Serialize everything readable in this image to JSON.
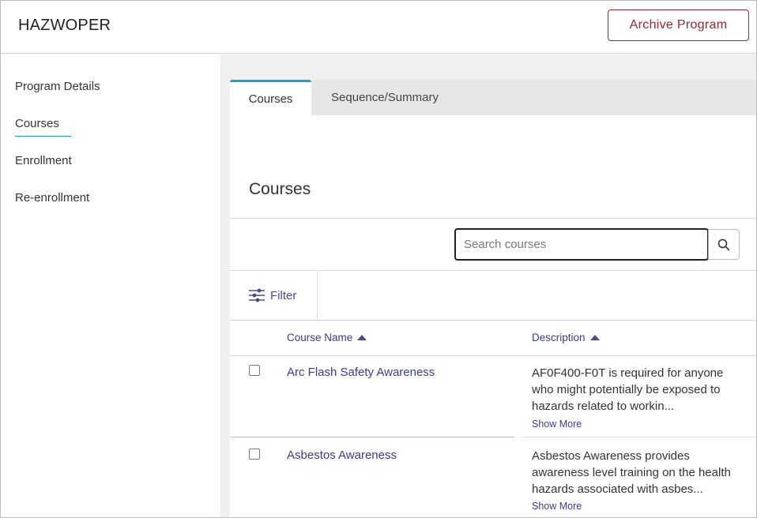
{
  "header": {
    "title": "HAZWOPER",
    "archive_label": "Archive Program"
  },
  "sidebar": {
    "items": [
      {
        "label": "Program Details"
      },
      {
        "label": "Courses",
        "active": true
      },
      {
        "label": "Enrollment"
      },
      {
        "label": "Re-enrollment"
      }
    ]
  },
  "tabs": [
    {
      "label": "Courses",
      "active": true
    },
    {
      "label": "Sequence/Summary"
    }
  ],
  "panel": {
    "title": "Courses",
    "search": {
      "placeholder": "Search courses",
      "value": ""
    },
    "filter_label": "Filter",
    "columns": [
      {
        "label": "Course Name",
        "sort": "asc"
      },
      {
        "label": "Description",
        "sort": "asc"
      }
    ],
    "rows": [
      {
        "name": "Arc Flash Safety Awareness",
        "description": "AF0F400-F0T is required for anyone who might potentially be exposed to hazards related to workin...",
        "more": "Show More",
        "checked": false
      },
      {
        "name": "Asbestos Awareness",
        "description": "Asbestos Awareness provides awareness level training on the health hazards associated with asbes...",
        "more": "Show More",
        "checked": false
      }
    ]
  },
  "colors": {
    "accent": "#1aa0c9",
    "link": "#3b3b8a",
    "danger": "#9b2335"
  }
}
